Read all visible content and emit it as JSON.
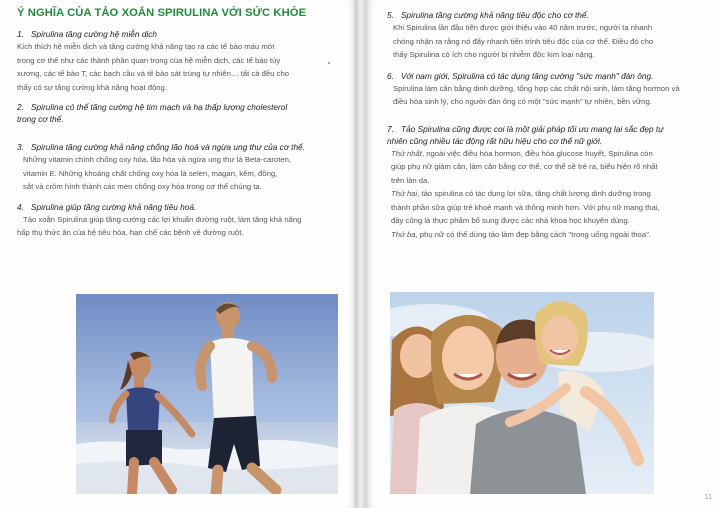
{
  "left_page": {
    "title": "Ý NGHĨA CỦA TẢO XOẮN SPIRULINA VỚI SỨC KHỎE",
    "items": [
      {
        "number": "1.",
        "heading": "Spirulina tăng cường hệ miễn dịch",
        "body": [
          "Kích thích hệ miễn dịch và tăng cường khả năng tạo ra các tế bào máu mới",
          "trong cơ thể như các thành phần quan trọng của hệ miễn dịch, các tế bào tủy",
          "xương, các tế bào T, các bạch cầu và tế bào sát trùng tự nhiên… tất cả đều cho",
          "thấy có sự tăng cường khả năng hoạt động."
        ]
      },
      {
        "number": "2.",
        "heading": "Spirulina có thể tăng cường hệ tim mạch và hạ thấp lượng cholesterol",
        "heading_cont": "trong cơ thể."
      },
      {
        "number": "3.",
        "heading": "Spirulina tăng cường khả năng chống lão hoá và ngừa ung thư của cơ thể.",
        "body": [
          "Những vitamin chính chống oxy hóa, lão hóa và ngừa ung thư là Beta-caroten,",
          "vitamin E. Những khoáng chất chống oxy hóa là selen, magan, kẽm, đồng,",
          "sắt và crôm hình thành các men chống oxy hóa trong cơ thể chúng ta."
        ]
      },
      {
        "number": "4.",
        "heading": "Spirulina giúp tăng cường khả năng tiêu hoá.",
        "body": [
          "Tảo xoắn Spirulina giúp tăng cường các lợi khuẩn đường ruột, làm tăng khả năng",
          "hấp thụ thức ăn của hệ tiêu hóa, hạn chế các bệnh về đường ruột."
        ]
      }
    ]
  },
  "right_page": {
    "items": [
      {
        "number": "5.",
        "heading": "Spirulina tăng cường khả năng tiêu độc cho cơ thể.",
        "body": [
          "Khi Spirulina lần đầu tiên được giới thiệu vào 40 năm trước, người ta nhanh",
          "chóng nhận ra rằng nó đẩy nhanh tiến trình tiêu độc của cơ thể. Điều đó cho",
          "thấy Spirulina có ích cho người bị nhiễm độc kim loại nặng."
        ]
      },
      {
        "number": "6.",
        "heading": "Với nam giới, Spirulina có tác dụng tăng cường \"sức mạnh\" đàn ông.",
        "body": [
          "Spirulina làm cân bằng dinh dưỡng, tổng hợp các chất nội sinh, làm tăng hormon và",
          "điều hòa sinh lý, cho người đàn ông có một \"sức mạnh\" tự nhiên, bền vững."
        ]
      },
      {
        "number": "7.",
        "heading": "Tảo Spirulina cũng được coi là một giải pháp tối ưu mang lại sắc đẹp tự",
        "heading_cont": "nhiên cũng nhiều tác động rất hữu hiệu cho cơ thể nữ giới.",
        "body_parts": [
          {
            "lead": "Thứ nhất",
            "text": ", ngoài việc điều hòa hormon, điều hòa glucose huyết, Spirulina còn"
          },
          {
            "lead": "",
            "text": "giúp phụ nữ giảm cân, làm cân bằng cơ thể, cơ thể sẽ trẻ ra, biểu hiện rõ nhất"
          },
          {
            "lead": "",
            "text": "trên làn da."
          },
          {
            "lead": "Thứ hai",
            "text": ", tảo spirulina có tác dụng lợi sữa, tăng chất lượng dinh dưỡng trong"
          },
          {
            "lead": "",
            "text": "thành phần sữa giúp trẻ khoẻ mạnh và thông minh hơn. Với phụ nữ mang thai,"
          },
          {
            "lead": "",
            "text": "đây cũng là thực phẩm bổ sung được các nhà khoa học khuyên dùng."
          },
          {
            "lead": "Thứ ba",
            "text": ", phụ nữ có thể dùng tảo làm đẹp bằng cách \"trong uống ngoài thoa\"."
          }
        ]
      }
    ],
    "page_number": "11"
  },
  "colors": {
    "title_green": "#1f8a3c",
    "heading_text": "#222222",
    "body_text": "#555555"
  }
}
